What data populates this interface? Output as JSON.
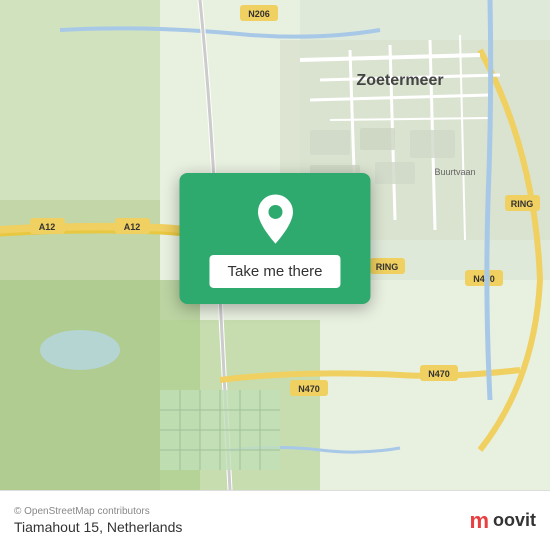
{
  "map": {
    "background_color": "#e8f0e0",
    "center_lat": 52.04,
    "center_lng": 4.49
  },
  "card": {
    "button_label": "Take me there",
    "pin_color": "#ffffff"
  },
  "footer": {
    "attribution": "© OpenStreetMap contributors",
    "address": "Tiamahout 15, Netherlands",
    "logo_m": "m",
    "logo_text": "oovit"
  }
}
